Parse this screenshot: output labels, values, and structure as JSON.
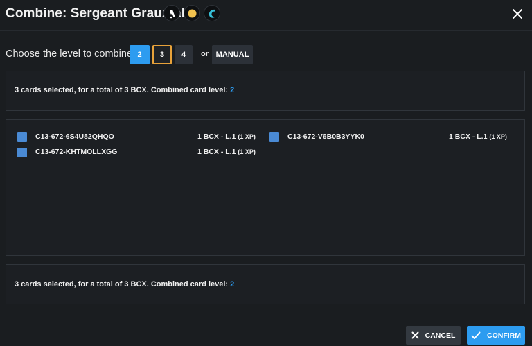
{
  "dialog": {
    "title": "Combine: Sergeant Grauzral",
    "badges": [
      {
        "icon": "water-splash-icon",
        "color": "#ffffff"
      },
      {
        "icon": "gold-foil-icon",
        "color": "#f2c24e"
      },
      {
        "icon": "water-element-icon",
        "color": "#37c0d8"
      }
    ],
    "close_icon": "close-icon"
  },
  "level_selector": {
    "label": "Choose the level to combine:",
    "options": [
      "2",
      "3",
      "4"
    ],
    "selected": "2",
    "or_text": "or",
    "manual_label": "MANUAL"
  },
  "summary_top": {
    "text": "3 cards selected, for a total of 3 BCX. Combined card level:",
    "level": "2"
  },
  "cards": [
    {
      "id": "C13-672-6S4U82QHQO",
      "bcx": "1 BCX - L.1",
      "xp": "(1 XP)"
    },
    {
      "id": "C13-672-V6B0B3YYK0",
      "bcx": "1 BCX - L.1",
      "xp": "(1 XP)"
    },
    {
      "id": "C13-672-KHTMOLLXGG",
      "bcx": "1 BCX - L.1",
      "xp": "(1 XP)"
    }
  ],
  "summary_bottom": {
    "text": "3 cards selected, for a total of 3 BCX. Combined card level:",
    "level": "2"
  },
  "footer": {
    "cancel_label": "CANCEL",
    "confirm_label": "CONFIRM"
  },
  "colors": {
    "accent": "#2d9cf0",
    "outline": "#e8a23a",
    "checkbox": "#4a8ad4",
    "background": "#1a1d20"
  }
}
